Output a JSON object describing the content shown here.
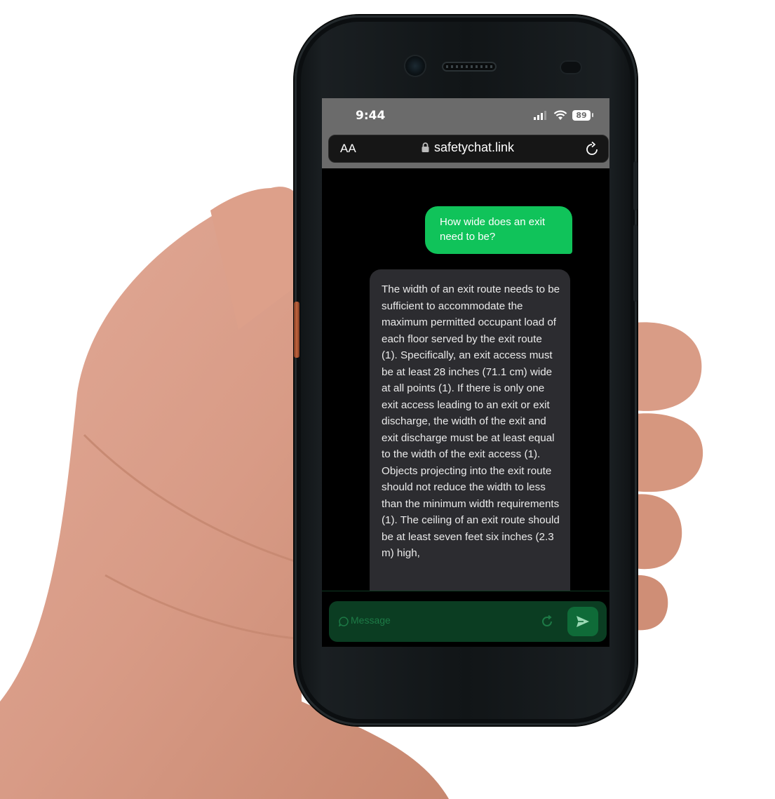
{
  "status_bar": {
    "time": "9:44",
    "battery": "89"
  },
  "browser": {
    "text_size_label": "AA",
    "url": "safetychat.link"
  },
  "chat": {
    "user_message": "How wide does an exit need to be?",
    "assistant_message": "The width of an exit route needs to be sufficient to accommodate the maximum permitted occupant load of each floor served by the exit route (1). Specifically, an exit access must be at least 28 inches (71.1 cm) wide at all points (1). If there is only one exit access leading to an exit or exit discharge, the width of the exit and exit discharge must be at least equal to the width of the exit access (1). Objects projecting into the exit route should not reduce the width to less than the minimum width requirements (1). The ceiling of an exit route should be at least seven feet six inches (2.3 m) high,"
  },
  "composer": {
    "placeholder": "Message"
  },
  "colors": {
    "accent": "#10c35a",
    "assistant_bubble": "#2c2c30",
    "composer": "#0b3d22"
  }
}
